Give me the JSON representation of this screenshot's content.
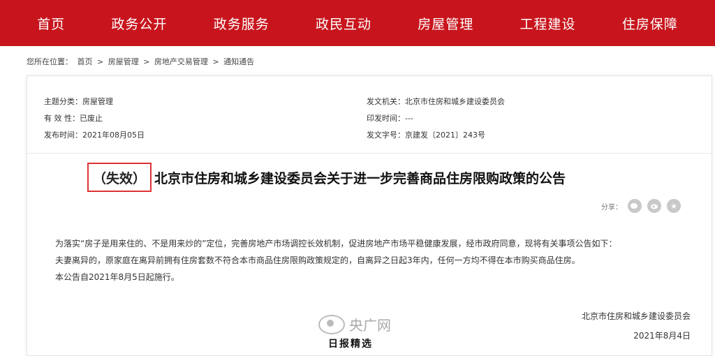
{
  "nav": [
    "首页",
    "政务公开",
    "政务服务",
    "政民互动",
    "房屋管理",
    "工程建设",
    "住房保障"
  ],
  "breadcrumb": {
    "prefix": "您所在位置：",
    "items": [
      "首页",
      "房屋管理",
      "房地产交易管理",
      "通知通告"
    ],
    "separator": ">"
  },
  "meta": {
    "left": [
      {
        "key": "主题分类：",
        "value": "房屋管理"
      },
      {
        "key": "有 效 性：",
        "value": "已废止"
      },
      {
        "key": "发布时间：",
        "value": "2021年08月05日"
      }
    ],
    "right": [
      {
        "key": "发文机关：",
        "value": "北京市住房和城乡建设委员会"
      },
      {
        "key": "印发时间：",
        "value": "---"
      },
      {
        "key": "发文字号：",
        "value": "京建发〔2021〕243号"
      }
    ]
  },
  "title": {
    "badge": "（失效）",
    "text": "北京市住房和城乡建设委员会关于进一步完善商品住房限购政策的公告"
  },
  "share": {
    "label": "分享："
  },
  "body": [
    "为落实“房子是用来住的、不是用来炒的”定位，完善房地产市场调控长效机制，促进房地产市场平稳健康发展，经市政府同意，现将有关事项公告如下：",
    "夫妻离异的，原家庭在离异前拥有住房套数不符合本市商品住房限购政策规定的，自离异之日起3年内，任何一方均不得在本市购买商品住房。",
    "本公告自2021年8月5日起施行。"
  ],
  "signature": {
    "org": "北京市住房和城乡建设委员会",
    "date": "2021年8月4日"
  },
  "watermark": "央广网",
  "bottom_fragment": "日报精选",
  "colors": {
    "nav_bg": "#c8151d",
    "badge_border": "#d33333"
  }
}
